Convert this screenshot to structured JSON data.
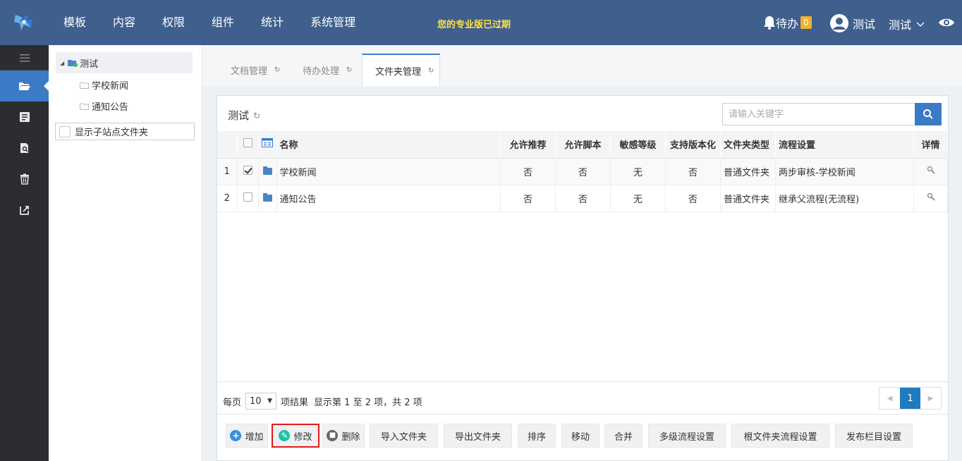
{
  "header": {
    "nav": [
      "模板",
      "内容",
      "权限",
      "组件",
      "统计",
      "系统管理"
    ],
    "expired_notice": "您的专业版已过期",
    "todo_label": "待办",
    "todo_count": "0",
    "user_name": "测试",
    "user_menu_label": "测试"
  },
  "tree": {
    "root": "测试",
    "children": [
      "学校新闻",
      "通知公告"
    ],
    "show_subsite_label": "显示子站点文件夹"
  },
  "tabs": [
    "文档管理",
    "待办处理",
    "文件夹管理"
  ],
  "panel": {
    "title": "测试",
    "search_placeholder": "请输入关键字"
  },
  "table": {
    "headers": [
      "名称",
      "允许推荐",
      "允许脚本",
      "敏感等级",
      "支持版本化",
      "文件夹类型",
      "流程设置",
      "详情"
    ],
    "rows": [
      {
        "index": "1",
        "checked": true,
        "name": "学校新闻",
        "recommend": "否",
        "script": "否",
        "sensitivity": "无",
        "versioning": "否",
        "type": "普通文件夹",
        "flow": "两步审核-学校新闻"
      },
      {
        "index": "2",
        "checked": false,
        "name": "通知公告",
        "recommend": "否",
        "script": "否",
        "sensitivity": "无",
        "versioning": "否",
        "type": "普通文件夹",
        "flow": "继承父流程(无流程)"
      }
    ]
  },
  "pager": {
    "per_page_label": "每页",
    "per_page_value": "10",
    "items_label": "项结果",
    "summary": "显示第 1 至 2 项，共 2 项",
    "current_page": "1"
  },
  "toolbar": {
    "add": "增加",
    "edit": "修改",
    "delete": "删除",
    "import": "导入文件夹",
    "export": "导出文件夹",
    "sort": "排序",
    "move": "移动",
    "merge": "合并",
    "multi_flow": "多级流程设置",
    "root_flow": "根文件夹流程设置",
    "publish": "发布栏目设置"
  },
  "colors": {
    "header_bg": "#3f5f8c",
    "accent": "#3b7bc6",
    "expired": "#ffe14b",
    "sidebar_bg": "#2b2d30",
    "highlight": "#e11b1b"
  }
}
